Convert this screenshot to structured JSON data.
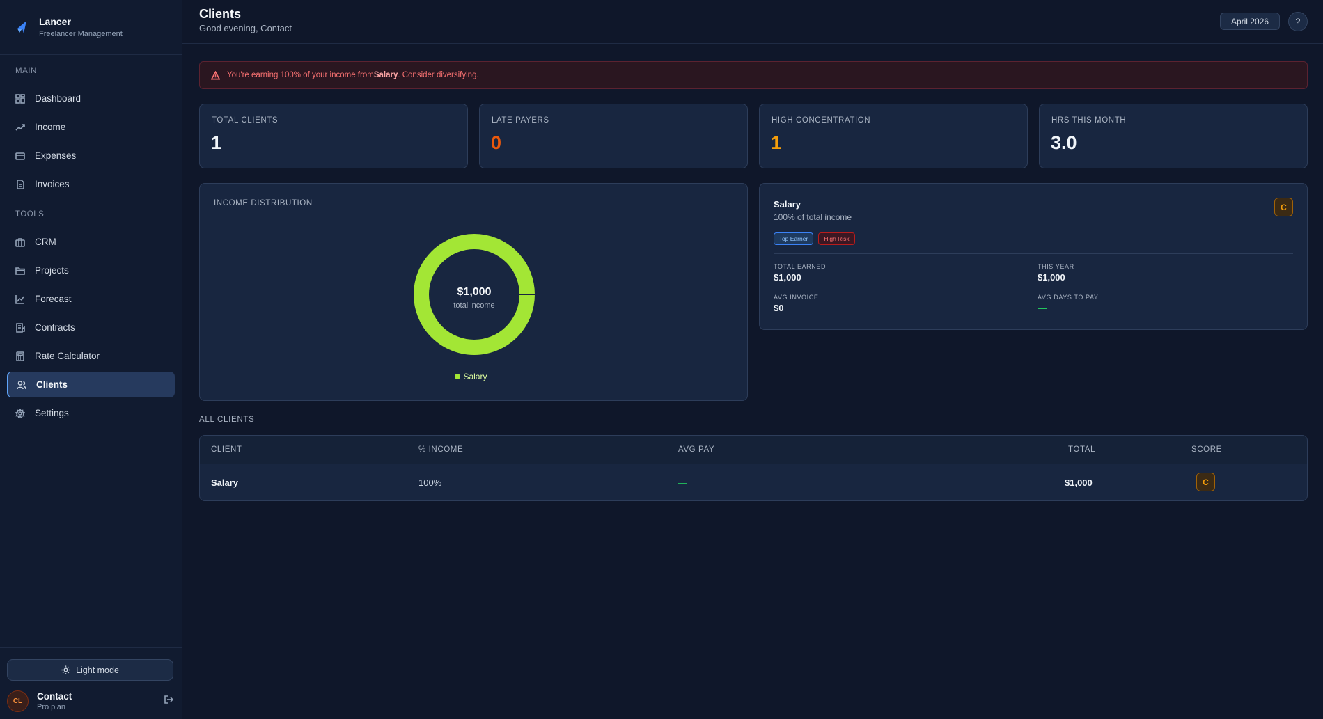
{
  "brand": {
    "name": "Lancer",
    "subtitle": "Freelancer Management"
  },
  "sidebar": {
    "main_label": "MAIN",
    "tools_label": "TOOLS",
    "main_items": [
      {
        "label": "Dashboard",
        "icon": "grid-icon"
      },
      {
        "label": "Income",
        "icon": "trending-up-icon"
      },
      {
        "label": "Expenses",
        "icon": "card-icon"
      },
      {
        "label": "Invoices",
        "icon": "document-icon"
      }
    ],
    "tool_items": [
      {
        "label": "CRM",
        "icon": "briefcase-icon"
      },
      {
        "label": "Projects",
        "icon": "folder-icon"
      },
      {
        "label": "Forecast",
        "icon": "chart-line-icon"
      },
      {
        "label": "Contracts",
        "icon": "contract-icon"
      },
      {
        "label": "Rate Calculator",
        "icon": "calculator-icon"
      },
      {
        "label": "Clients",
        "icon": "users-icon",
        "active": true
      },
      {
        "label": "Settings",
        "icon": "gear-icon"
      }
    ],
    "light_mode_label": "Light mode",
    "user": {
      "initials": "CL",
      "name": "Contact",
      "plan": "Pro plan"
    }
  },
  "header": {
    "title": "Clients",
    "greeting": "Good evening, Contact",
    "month": "April 2026",
    "help": "?"
  },
  "alert": {
    "prefix": "You're earning 100% of your income from ",
    "client": "Salary",
    "suffix": ". Consider diversifying."
  },
  "stats": [
    {
      "label": "TOTAL CLIENTS",
      "value": "1"
    },
    {
      "label": "LATE PAYERS",
      "value": "0"
    },
    {
      "label": "HIGH CONCENTRATION",
      "value": "1"
    },
    {
      "label": "HRS THIS MONTH",
      "value": "3.0"
    }
  ],
  "distribution": {
    "title": "INCOME DISTRIBUTION",
    "center_value": "$1,000",
    "center_label": "total income",
    "slices": [
      {
        "name": "Salary",
        "percent": 100,
        "color": "#a3e635"
      }
    ]
  },
  "client_card": {
    "name": "Salary",
    "share": "100% of total income",
    "score": "C",
    "tags": [
      "Top Earner",
      "High Risk"
    ],
    "total_earned_label": "TOTAL EARNED",
    "total_earned": "$1,000",
    "this_year_label": "THIS YEAR",
    "this_year": "$1,000",
    "avg_invoice_label": "AVG INVOICE",
    "avg_invoice": "$0",
    "avg_days_label": "AVG DAYS TO PAY",
    "avg_days": "—"
  },
  "table": {
    "section_title": "ALL CLIENTS",
    "columns": [
      "CLIENT",
      "% INCOME",
      "AVG PAY",
      "TOTAL",
      "SCORE"
    ],
    "rows": [
      {
        "client": "Salary",
        "percent": "100%",
        "avg_pay": "—",
        "total": "$1,000",
        "score": "C"
      }
    ]
  },
  "colors": {
    "accent": "#60a5fa",
    "warning": "#f59e0b",
    "danger": "#f87171",
    "chart": "#a3e635"
  }
}
